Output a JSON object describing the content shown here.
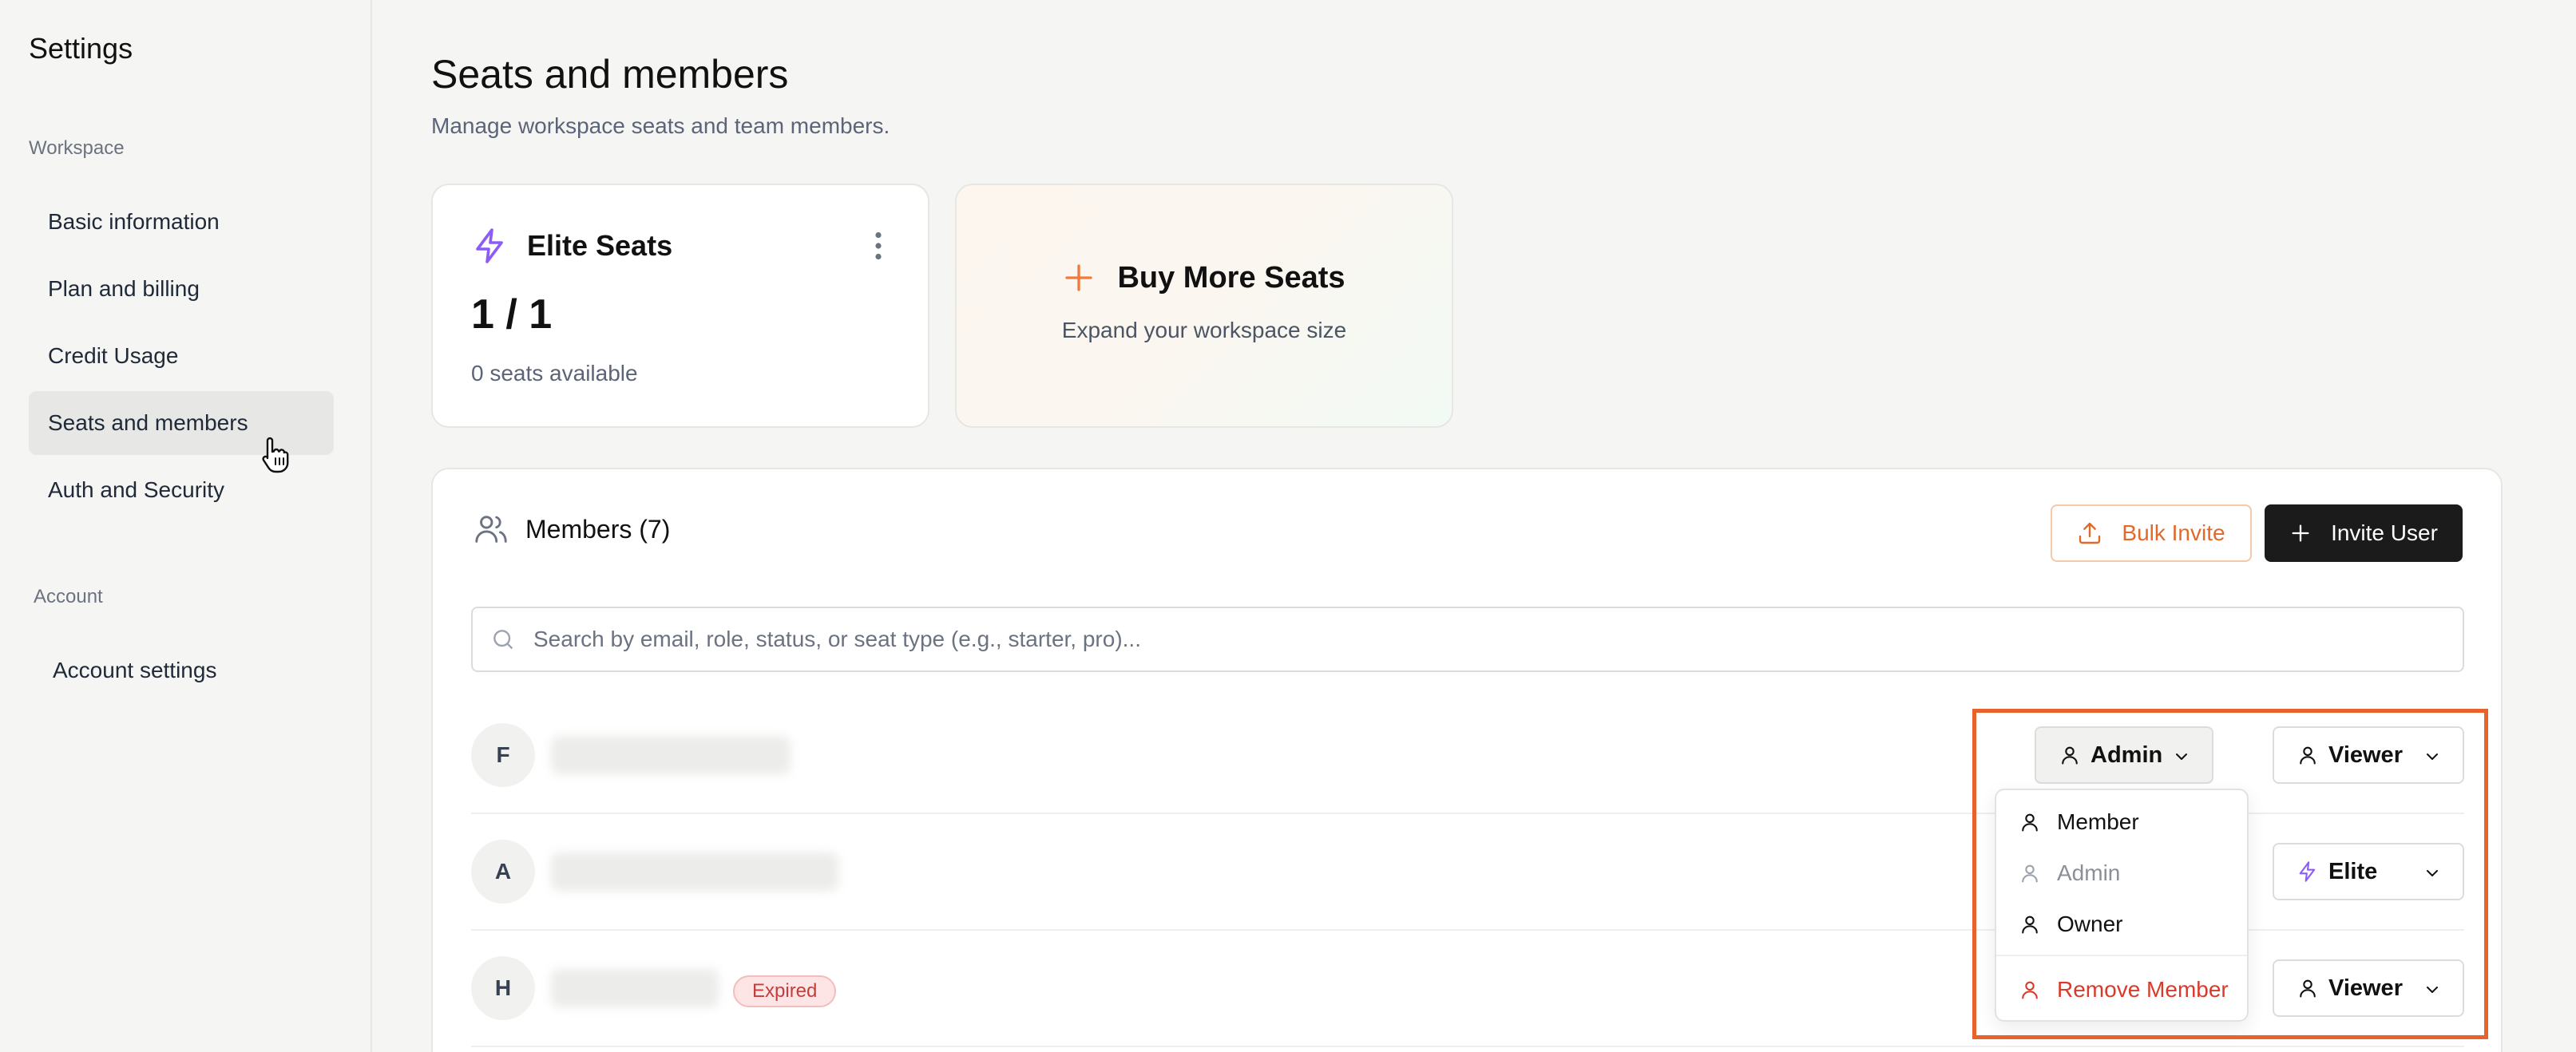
{
  "sidebar": {
    "title": "Settings",
    "sections": {
      "workspace": "Workspace",
      "account": "Account"
    },
    "items": [
      {
        "label": "Basic information"
      },
      {
        "label": "Plan and billing"
      },
      {
        "label": "Credit Usage"
      },
      {
        "label": "Seats and members",
        "active": true
      },
      {
        "label": "Auth and Security"
      }
    ],
    "account_items": [
      {
        "label": "Account settings"
      }
    ]
  },
  "page": {
    "title": "Seats and members",
    "subtitle": "Manage workspace seats and team members."
  },
  "elite_card": {
    "title": "Elite Seats",
    "count": "1 / 1",
    "available": "0 seats available",
    "icon": "lightning-icon",
    "accent": "#8b5cf6"
  },
  "buy_card": {
    "title": "Buy More Seats",
    "subtitle": "Expand your workspace size",
    "icon": "plus-icon",
    "accent": "#f07a3c"
  },
  "members": {
    "title": "Members (7)",
    "bulk_invite_label": "Bulk Invite",
    "invite_user_label": "Invite User",
    "search_placeholder": "Search by email, role, status, or seat type (e.g., starter, pro)...",
    "rows": [
      {
        "initial": "F",
        "role": "Admin",
        "seat": "Viewer"
      },
      {
        "initial": "A",
        "seat": "Elite"
      },
      {
        "initial": "H",
        "badge": "Expired",
        "seat": "Viewer"
      }
    ]
  },
  "role_dropdown": {
    "options": [
      {
        "label": "Member"
      },
      {
        "label": "Admin",
        "disabled": true
      },
      {
        "label": "Owner"
      }
    ],
    "remove_label": "Remove Member"
  },
  "colors": {
    "highlight": "#e8622c",
    "danger": "#d93a2b",
    "elite": "#8b5cf6"
  }
}
